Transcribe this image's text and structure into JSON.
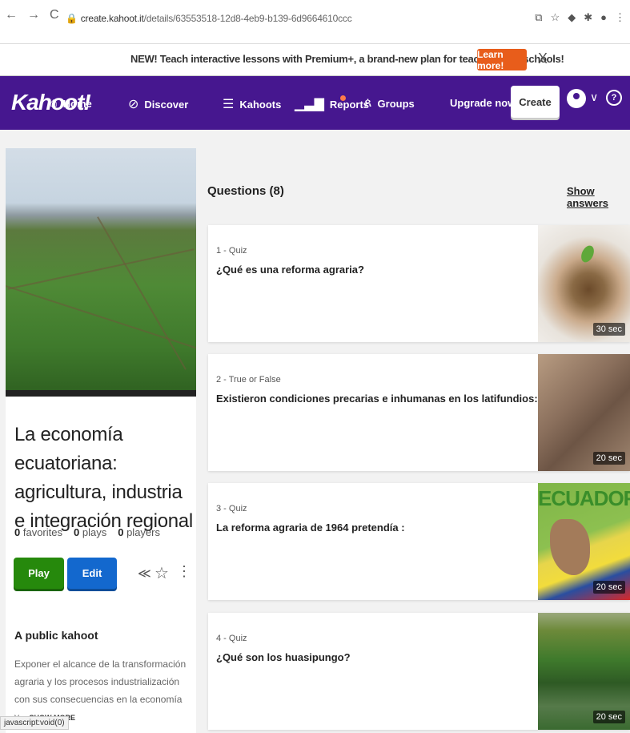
{
  "browser": {
    "url_host": "create.kahoot.it",
    "url_path": "/details/63553518-12d8-4eb9-b139-6d9664610ccc"
  },
  "banner": {
    "text": "NEW! Teach interactive lessons with Premium+, a brand-new plan for teachers and schools!",
    "learn_more": "Learn more!",
    "close": "X"
  },
  "nav": {
    "logo": "Kahoot!",
    "items": [
      {
        "label": "Home",
        "icon": "home-icon"
      },
      {
        "label": "Discover",
        "icon": "compass-icon"
      },
      {
        "label": "Kahoots",
        "icon": "list-icon"
      },
      {
        "label": "Reports",
        "icon": "bar-chart-icon"
      },
      {
        "label": "Groups",
        "icon": "people-icon"
      }
    ],
    "upgrade": "Upgrade now",
    "create": "Create",
    "help": "?"
  },
  "kahoot": {
    "title": "La economía ecuatoriana: agricultura, industria e integración regional",
    "favorites_count": "0",
    "favorites_label": "favorites",
    "plays_count": "0",
    "plays_label": "plays",
    "players_count": "0",
    "players_label": "players",
    "play": "Play",
    "edit": "Edit",
    "visibility": "A public kahoot",
    "description": "Exponer el alcance de la transformación agraria y los procesos industrialización con sus consecuencias en la economía y...",
    "show_more": "SHOW MORE"
  },
  "status_bar": "javascript:void(0)",
  "questions": {
    "header": "Questions (8)",
    "show_answers": "Show answers",
    "items": [
      {
        "meta": "1 - Quiz",
        "text": "¿Qué es una reforma agraria?",
        "time": "30 sec"
      },
      {
        "meta": "2 - True or False",
        "text": "Existieron condiciones precarias e inhumanas en los latifundios:",
        "time": "20 sec"
      },
      {
        "meta": "3 - Quiz",
        "text": "La reforma agraria de 1964 pretendía :",
        "time": "20 sec",
        "image_text": "ECUADOR"
      },
      {
        "meta": "4 - Quiz",
        "text": "¿Qué son los huasipungo?",
        "time": "20 sec"
      }
    ]
  }
}
